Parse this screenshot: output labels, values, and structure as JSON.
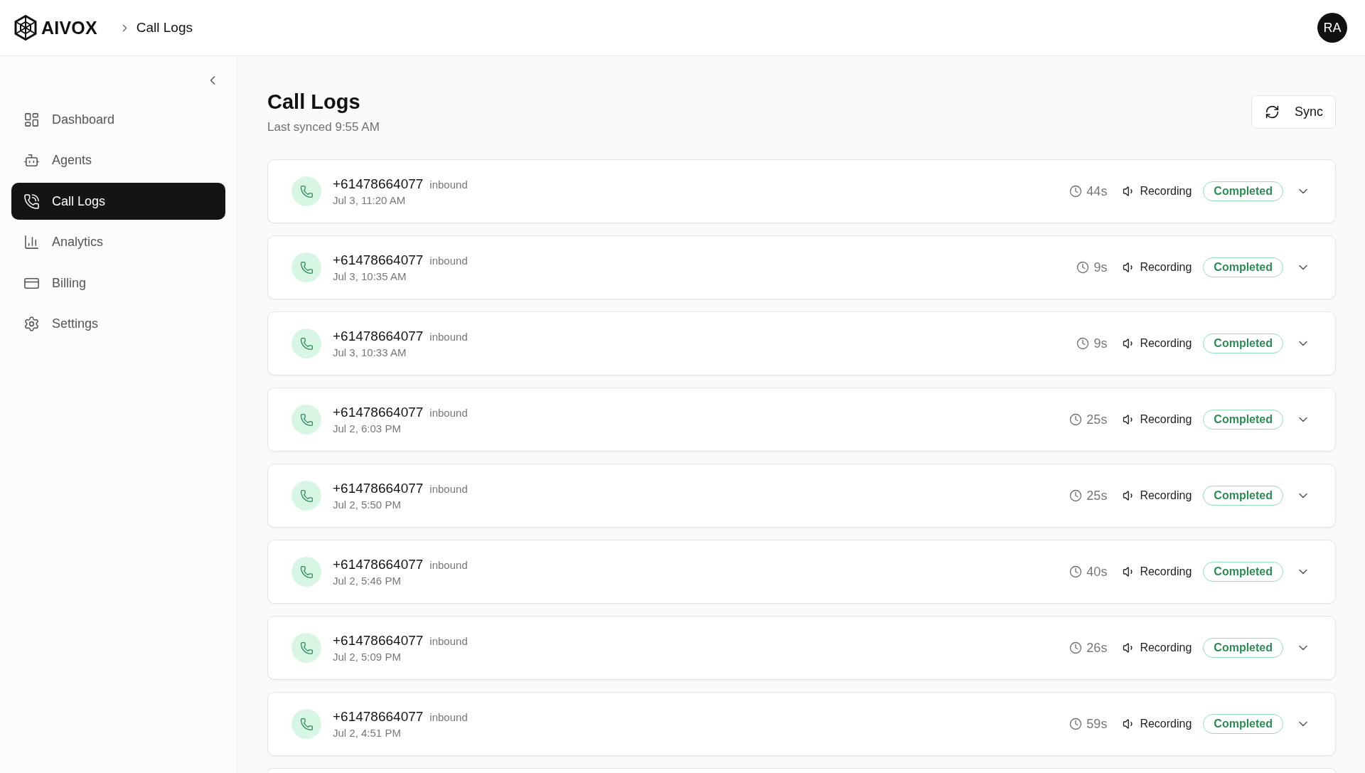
{
  "header": {
    "brand": "AIVOX",
    "breadcrumb": [
      {
        "label": "Call Logs"
      }
    ],
    "avatar": "RA"
  },
  "sidebar": {
    "items": [
      {
        "label": "Dashboard",
        "selected": false
      },
      {
        "label": "Agents",
        "selected": false
      },
      {
        "label": "Call Logs",
        "selected": true
      },
      {
        "label": "Analytics",
        "selected": false
      },
      {
        "label": "Billing",
        "selected": false
      },
      {
        "label": "Settings",
        "selected": false
      }
    ]
  },
  "page": {
    "title": "Call Logs",
    "subtitle": "Last synced 9:55 AM",
    "sync_button": "Sync"
  },
  "calls": [
    {
      "number": "+61478664077",
      "direction": "inbound",
      "time": "Jul 3, 11:20 AM",
      "duration": "44s",
      "recording": "Recording",
      "status": "Completed"
    },
    {
      "number": "+61478664077",
      "direction": "inbound",
      "time": "Jul 3, 10:35 AM",
      "duration": "9s",
      "recording": "Recording",
      "status": "Completed"
    },
    {
      "number": "+61478664077",
      "direction": "inbound",
      "time": "Jul 3, 10:33 AM",
      "duration": "9s",
      "recording": "Recording",
      "status": "Completed"
    },
    {
      "number": "+61478664077",
      "direction": "inbound",
      "time": "Jul 2, 6:03 PM",
      "duration": "25s",
      "recording": "Recording",
      "status": "Completed"
    },
    {
      "number": "+61478664077",
      "direction": "inbound",
      "time": "Jul 2, 5:50 PM",
      "duration": "25s",
      "recording": "Recording",
      "status": "Completed"
    },
    {
      "number": "+61478664077",
      "direction": "inbound",
      "time": "Jul 2, 5:46 PM",
      "duration": "40s",
      "recording": "Recording",
      "status": "Completed"
    },
    {
      "number": "+61478664077",
      "direction": "inbound",
      "time": "Jul 2, 5:09 PM",
      "duration": "26s",
      "recording": "Recording",
      "status": "Completed"
    },
    {
      "number": "+61478664077",
      "direction": "inbound",
      "time": "Jul 2, 4:51 PM",
      "duration": "59s",
      "recording": "Recording",
      "status": "Completed"
    }
  ]
}
